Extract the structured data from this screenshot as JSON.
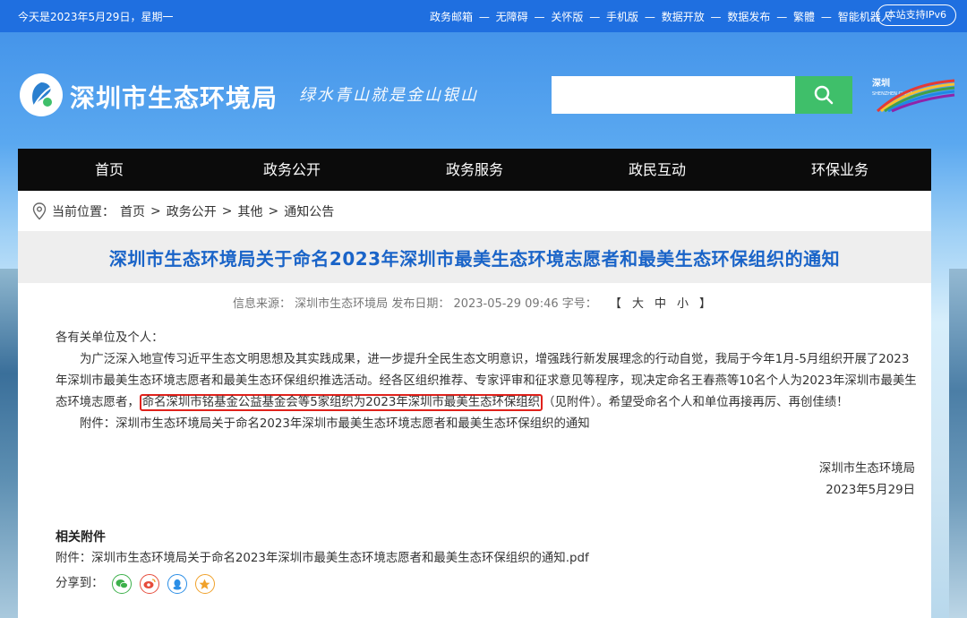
{
  "topbar": {
    "date": "今天是2023年5月29日，星期一",
    "links": [
      "政务邮箱",
      "无障碍",
      "关怀版",
      "手机版",
      "数据开放",
      "数据发布",
      "繁體",
      "智能机器人"
    ],
    "separator": "—",
    "ipv6_label": "本站支持IPv6"
  },
  "header": {
    "site_name": "深圳市生态环境局",
    "slogan": "绿水青山就是金山银山",
    "search_placeholder": "",
    "city_logo_text": "深圳",
    "city_logo_sub": "SHENZHEN CHINA"
  },
  "nav": {
    "items": [
      "首页",
      "政务公开",
      "政务服务",
      "政民互动",
      "环保业务"
    ]
  },
  "breadcrumb": {
    "label": "当前位置：",
    "items": [
      "首页",
      "政务公开",
      "其他",
      "通知公告"
    ],
    "separator": ">"
  },
  "article": {
    "title": "深圳市生态环境局关于命名2023年深圳市最美生态环境志愿者和最美生态环保组织的通知",
    "meta": {
      "source_label": "信息来源：",
      "source": "深圳市生态环境局",
      "date_label": "发布日期：",
      "date": "2023-05-29 09:46",
      "size_label": "字号：",
      "size_open": "【",
      "size_large": "大",
      "size_medium": "中",
      "size_small": "小",
      "size_close": "】"
    },
    "salutation": "各有关单位及个人：",
    "para1_before": "为广泛深入地宣传习近平生态文明思想及其实践成果，进一步提升全民生态文明意识，增强践行新发展理念的行动自觉，我局于今年1月-5月组织开展了2023年深圳市最美生态环境志愿者和最美生态环保组织推选活动。经各区组织推荐、专家评审和征求意见等程序，现决定命名王春燕等10名个人为2023年深圳市最美生态环境志愿者，",
    "para1_highlight": "命名深圳市铭基金公益基金会等5家组织为2023年深圳市最美生态环保组织",
    "para1_after": "（见附件）。希望受命名个人和单位再接再厉、再创佳绩！",
    "attachment_line": "附件：深圳市生态环境局关于命名2023年深圳市最美生态环境志愿者和最美生态环保组织的通知",
    "sign_org": "深圳市生态环境局",
    "sign_date": "2023年5月29日"
  },
  "related": {
    "heading": "相关附件",
    "file_line": "附件：深圳市生态环境局关于命名2023年深圳市最美生态环境志愿者和最美生态环保组织的通知.pdf",
    "share_label": "分享到："
  },
  "colors": {
    "topbar": "#1f6fe0",
    "nav_bg": "#0b0b0b",
    "title": "#1a64c8",
    "search_button": "#3fbf6a",
    "highlight_border": "#e0211b"
  }
}
